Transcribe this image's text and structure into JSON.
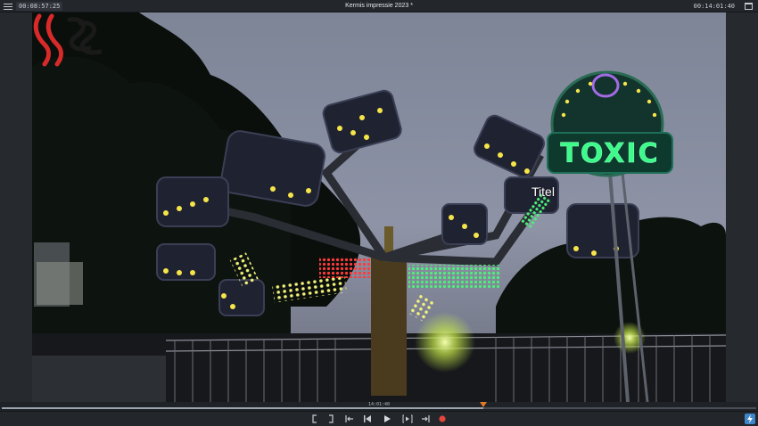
{
  "header": {
    "timecode_current": "00:08:57:25",
    "project_title": "Kermis impressie 2023 *",
    "timecode_total": "00:14:01:40"
  },
  "video": {
    "sign_text": "TOXIC",
    "overlay_title": "Titel"
  },
  "timeline": {
    "timecode": "14:01:40",
    "playhead_fraction": 0.638
  },
  "transport": {
    "buttons": [
      "mark-in",
      "mark-out",
      "go-to-in",
      "go-to-start",
      "play",
      "go-to-out",
      "go-to-end",
      "record"
    ]
  },
  "colors": {
    "record": "#e2463c",
    "playhead": "#e07b28",
    "accent": "#3f86c9"
  }
}
